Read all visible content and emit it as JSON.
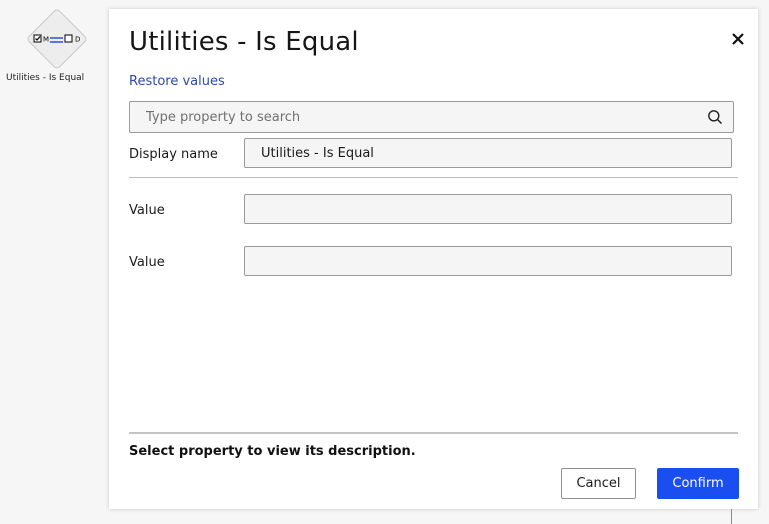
{
  "canvas": {
    "node": {
      "label": "Utilities - Is Equal",
      "icon": "compare-icon",
      "icon_left_text": "M",
      "icon_right_text": "D"
    }
  },
  "dialog": {
    "title": "Utilities - Is Equal",
    "close_icon": "close-icon",
    "restore_label": "Restore values",
    "search": {
      "placeholder": "Type property to search",
      "value": "",
      "icon": "search-icon"
    },
    "properties": [
      {
        "label": "Display name",
        "value": "Utilities - Is Equal"
      },
      {
        "label": "Value",
        "value": ""
      },
      {
        "label": "Value",
        "value": ""
      }
    ],
    "description": "Select property to view its description.",
    "buttons": {
      "cancel": "Cancel",
      "confirm": "Confirm"
    },
    "colors": {
      "accent": "#1a4ef0",
      "link": "#2c4aa8"
    }
  }
}
